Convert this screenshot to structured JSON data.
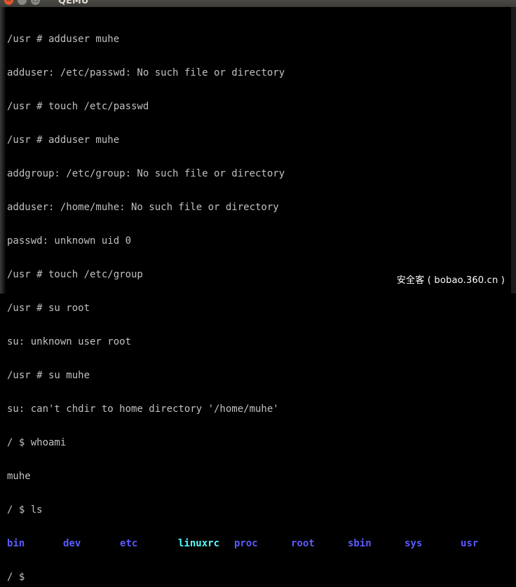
{
  "window": {
    "title": "QEMU",
    "close_glyph": "×",
    "minimize_glyph": "–",
    "maximize_glyph": "□"
  },
  "terminal": {
    "lines": [
      "/usr # adduser muhe",
      "adduser: /etc/passwd: No such file or directory",
      "/usr # touch /etc/passwd",
      "/usr # adduser muhe",
      "addgroup: /etc/group: No such file or directory",
      "adduser: /home/muhe: No such file or directory",
      "passwd: unknown uid 0",
      "/usr # touch /etc/group",
      "/usr # su root",
      "su: unknown user root",
      "/usr # su muhe",
      "su: can't chdir to home directory '/home/muhe'",
      "/ $ whoami",
      "muhe",
      "/ $ ls"
    ],
    "ls_output": [
      {
        "name": "bin",
        "color": "#5b5bff"
      },
      {
        "name": "dev",
        "color": "#5b5bff"
      },
      {
        "name": "etc",
        "color": "#5b5bff"
      },
      {
        "name": "linuxrc",
        "color": "#54fefe"
      },
      {
        "name": "proc",
        "color": "#5b5bff"
      },
      {
        "name": "root",
        "color": "#5b5bff"
      },
      {
        "name": "sbin",
        "color": "#5b5bff"
      },
      {
        "name": "sys",
        "color": "#5b5bff"
      },
      {
        "name": "usr",
        "color": "#5b5bff"
      }
    ],
    "prompt": "/ $"
  },
  "watermark": "安全客 ( bobao.360.cn )"
}
